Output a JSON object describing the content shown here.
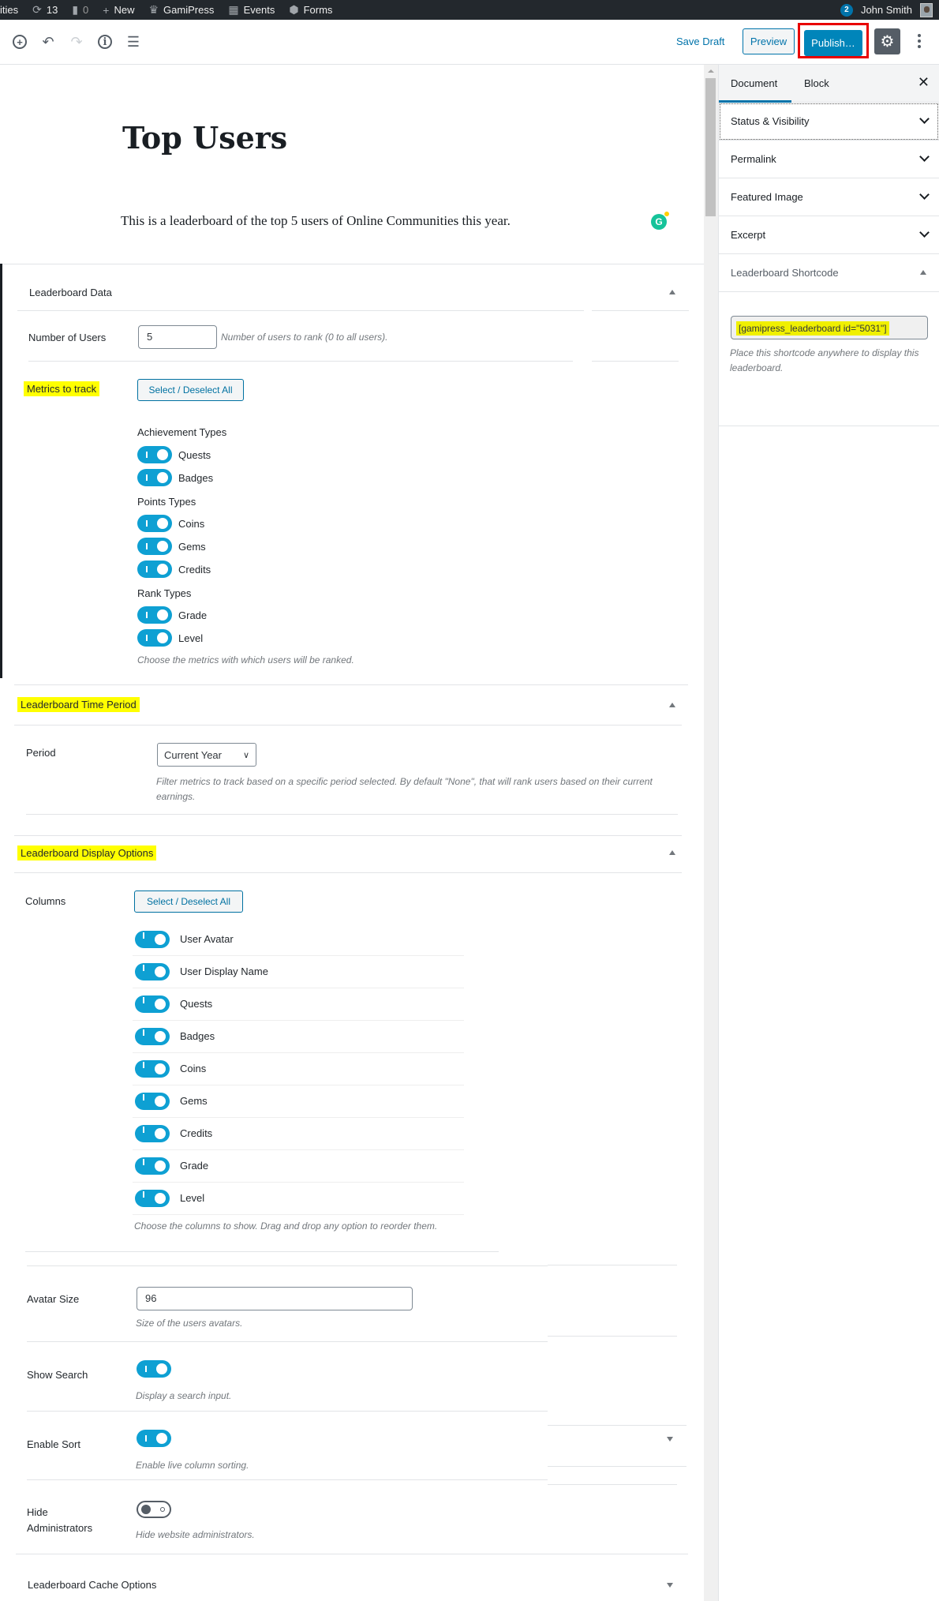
{
  "admin_bar": {
    "site_name": "ities",
    "updates_count": "13",
    "comments_count": "0",
    "new_label": "New",
    "gamipress_label": "GamiPress",
    "events_label": "Events",
    "forms_label": "Forms",
    "notifications_count": "2",
    "user_name": "John Smith"
  },
  "toolbar": {
    "save_draft_label": "Save Draft",
    "preview_label": "Preview",
    "publish_label": "Publish…"
  },
  "editor": {
    "title": "Top Users",
    "paragraph": "This is a leaderboard of the top 5 users of Online Communities this year.",
    "grammarly_label": "G"
  },
  "leaderboard_data": {
    "heading": "Leaderboard Data",
    "number_of_users_label": "Number of Users",
    "number_of_users_value": "5",
    "number_of_users_desc": "Number of users to rank (0 to all users).",
    "metrics_label": "Metrics to track",
    "select_all_label": "Select / Deselect All",
    "groups": [
      {
        "heading": "Achievement Types",
        "items": [
          {
            "label": "Quests",
            "on": true
          },
          {
            "label": "Badges",
            "on": true
          }
        ]
      },
      {
        "heading": "Points Types",
        "items": [
          {
            "label": "Coins",
            "on": true
          },
          {
            "label": "Gems",
            "on": true
          },
          {
            "label": "Credits",
            "on": true
          }
        ]
      },
      {
        "heading": "Rank Types",
        "items": [
          {
            "label": "Grade",
            "on": true
          },
          {
            "label": "Level",
            "on": true
          }
        ]
      }
    ],
    "metrics_desc": "Choose the metrics with which users will be ranked."
  },
  "time_period": {
    "heading": "Leaderboard Time Period",
    "period_label": "Period",
    "period_value": "Current Year",
    "period_desc": "Filter metrics to track based on a specific period selected. By default \"None\", that will rank users based on their current earnings."
  },
  "display_options": {
    "heading": "Leaderboard Display Options",
    "columns_label": "Columns",
    "select_all_label": "Select / Deselect All",
    "columns": [
      {
        "label": "User Avatar",
        "on": true
      },
      {
        "label": "User Display Name",
        "on": true
      },
      {
        "label": "Quests",
        "on": true
      },
      {
        "label": "Badges",
        "on": true
      },
      {
        "label": "Coins",
        "on": true
      },
      {
        "label": "Gems",
        "on": true
      },
      {
        "label": "Credits",
        "on": true
      },
      {
        "label": "Grade",
        "on": true
      },
      {
        "label": "Level",
        "on": true
      }
    ],
    "columns_desc": "Choose the columns to show. Drag and drop any option to reorder them.",
    "avatar_size_label": "Avatar Size",
    "avatar_size_value": "96",
    "avatar_size_desc": "Size of the users avatars.",
    "show_search_label": "Show Search",
    "show_search_on": true,
    "show_search_desc": "Display a search input.",
    "enable_sort_label": "Enable Sort",
    "enable_sort_on": true,
    "enable_sort_desc": "Enable live column sorting.",
    "hide_admins_label_1": "Hide",
    "hide_admins_label_2": "Administrators",
    "hide_admins_on": false,
    "hide_admins_desc": "Hide website administrators."
  },
  "cache_options": {
    "heading": "Leaderboard Cache Options"
  },
  "sidebar": {
    "tabs": [
      "Document",
      "Block"
    ],
    "active_tab": "Document",
    "panels": [
      "Status & Visibility",
      "Permalink",
      "Featured Image",
      "Excerpt"
    ],
    "shortcode_heading": "Leaderboard Shortcode",
    "shortcode_value": "[gamipress_leaderboard id=\"5031\"]",
    "shortcode_desc": "Place this shortcode anywhere to display this leaderboard."
  },
  "colors": {
    "accent": "#0073aa",
    "toggle_on": "#0ea0d3",
    "highlight": "#ffff00",
    "publish_outline": "#e80000"
  }
}
